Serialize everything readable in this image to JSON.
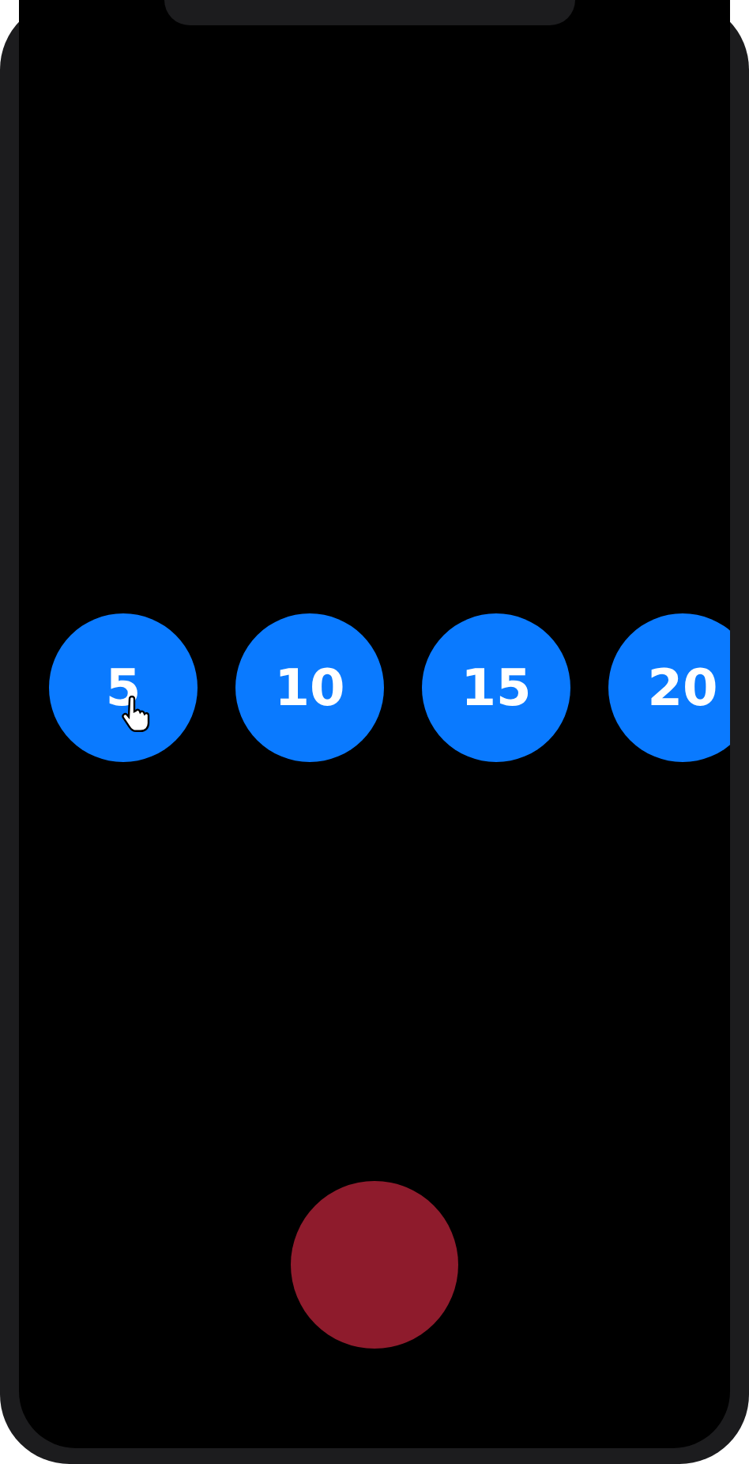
{
  "number_buttons": [
    {
      "label": "5"
    },
    {
      "label": "10"
    },
    {
      "label": "15"
    },
    {
      "label": "20"
    }
  ]
}
